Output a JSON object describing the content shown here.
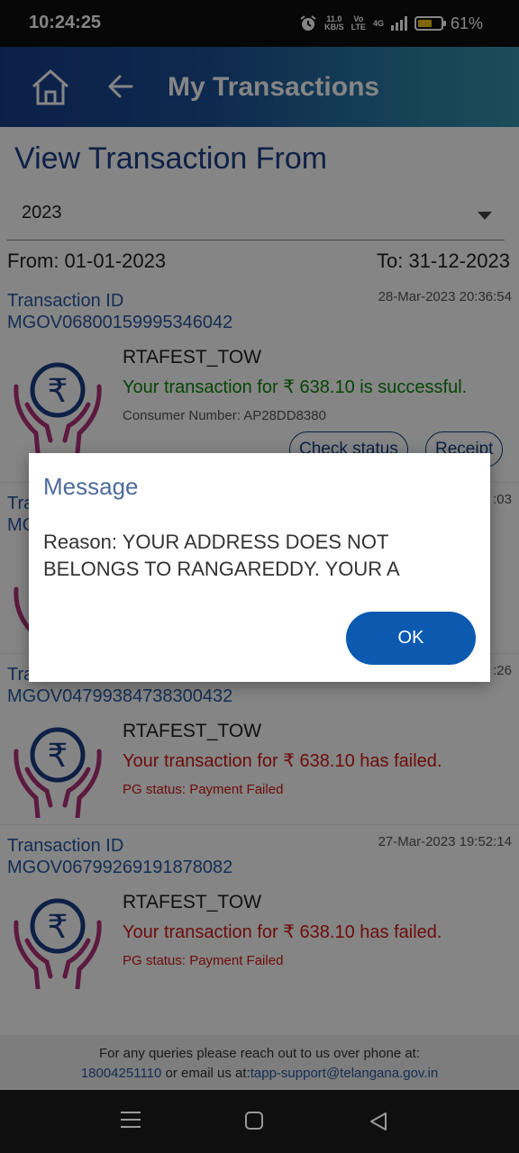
{
  "status_bar": {
    "time": "10:24:25",
    "net_speed_value": "11.0",
    "net_speed_unit": "KB/S",
    "volte": "Vo\nLTE",
    "network": "4G",
    "battery_level": 0.61,
    "battery": "61%",
    "battery_color": "#f5c518"
  },
  "header": {
    "title": "My Transactions",
    "home_icon": "home-icon",
    "back_icon": "arrow-left-icon"
  },
  "filter": {
    "heading": "View Transaction From",
    "year": "2023",
    "from": "From: 01-01-2023",
    "to": "To: 31-12-2023"
  },
  "transactions": [
    {
      "id_label": "Transaction ID",
      "id": "MGOV06800159995346042",
      "date": "28-Mar-2023 20:36:54",
      "service": "RTAFEST_TOW",
      "status": "Your transaction for ₹ 638.10 is successful.",
      "meta": "Consumer Number: AP28DD8380",
      "check_status": "Check status",
      "receipt": "Receipt"
    },
    {
      "id_label": "Tra",
      "id": "MG",
      "date": ":03"
    },
    {
      "id_label": "Tra",
      "id": "MGOV04799384738300432",
      "date": ":26",
      "service": "RTAFEST_TOW",
      "status": "Your transaction for ₹ 638.10 has failed.",
      "meta": "PG status: Payment Failed"
    },
    {
      "id_label": "Transaction ID",
      "id": "MGOV06799269191878082",
      "date": "27-Mar-2023 19:52:14",
      "service": "RTAFEST_TOW",
      "status": "Your transaction for ₹ 638.10 has failed.",
      "meta": "PG status: Payment Failed"
    }
  ],
  "footer": {
    "line1": "For any queries please reach out to us over phone at:",
    "phone": "18004251110",
    "mid": " or email us at:",
    "email": "tapp-support@telangana.gov.in"
  },
  "dialog": {
    "title": "Message",
    "message": "Reason: YOUR ADDRESS DOES NOT BELONGS TO RANGAREDDY. YOUR A",
    "ok": "OK"
  },
  "colors": {
    "brand_blue": "#1c3e86",
    "success": "#10830f",
    "failure": "#d21717",
    "ok_button": "#0b5ab0"
  }
}
